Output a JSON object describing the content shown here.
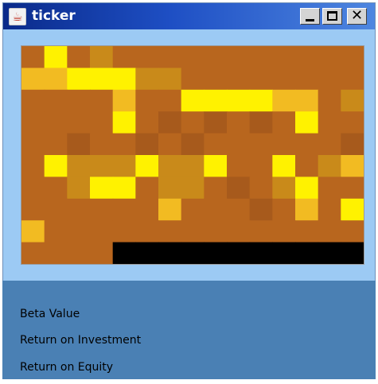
{
  "window": {
    "title": "ticker",
    "icon": "java-cup-icon",
    "controls": {
      "minimize": "minimize-icon",
      "maximize": "maximize-icon",
      "close": "close-icon"
    }
  },
  "chart_data": {
    "type": "heatmap",
    "rows": 10,
    "cols": 15,
    "levels": 6,
    "level_colors": [
      "#000000",
      "#a75a1c",
      "#b8661e",
      "#c98a1a",
      "#f2bb22",
      "#fff200"
    ],
    "grid": [
      [
        2,
        5,
        2,
        3,
        2,
        2,
        2,
        2,
        2,
        2,
        2,
        2,
        2,
        2,
        2
      ],
      [
        4,
        4,
        5,
        5,
        5,
        3,
        3,
        2,
        2,
        2,
        2,
        2,
        2,
        2,
        2
      ],
      [
        2,
        2,
        2,
        2,
        4,
        2,
        2,
        5,
        5,
        5,
        5,
        4,
        4,
        2,
        3
      ],
      [
        2,
        2,
        2,
        2,
        5,
        2,
        1,
        2,
        1,
        2,
        1,
        2,
        5,
        2,
        2
      ],
      [
        2,
        2,
        1,
        2,
        2,
        1,
        2,
        1,
        2,
        2,
        2,
        2,
        2,
        2,
        1
      ],
      [
        2,
        5,
        3,
        3,
        3,
        5,
        3,
        3,
        5,
        2,
        2,
        5,
        2,
        3,
        4
      ],
      [
        2,
        2,
        3,
        5,
        5,
        2,
        3,
        3,
        2,
        1,
        2,
        3,
        5,
        2,
        2
      ],
      [
        2,
        2,
        2,
        2,
        2,
        2,
        4,
        2,
        2,
        2,
        1,
        2,
        4,
        2,
        5
      ],
      [
        4,
        2,
        2,
        2,
        2,
        2,
        2,
        2,
        2,
        2,
        2,
        2,
        2,
        2,
        2
      ],
      [
        2,
        2,
        2,
        2,
        0,
        0,
        0,
        0,
        0,
        0,
        0,
        0,
        0,
        0,
        0
      ]
    ]
  },
  "info": {
    "labels": [
      "Beta Value",
      "Return on Investment",
      "Return on Equity"
    ]
  }
}
